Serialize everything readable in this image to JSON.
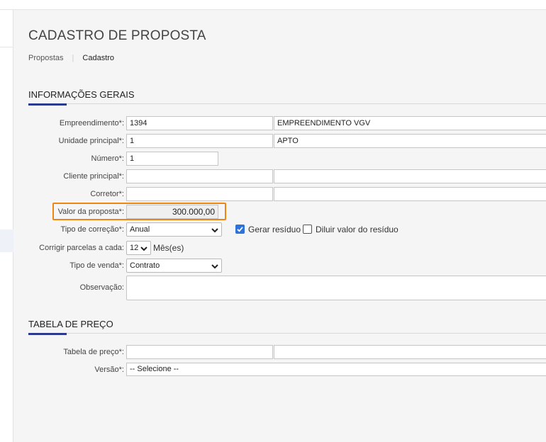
{
  "page": {
    "title": "CADASTRO DE PROPOSTA",
    "breadcrumb": {
      "parent": "Propostas",
      "current": "Cadastro"
    }
  },
  "sections": {
    "general": "INFORMAÇÕES GERAIS",
    "price": "TABELA DE PREÇO"
  },
  "fields": {
    "empreendimento": {
      "label": "Empreendimento*:",
      "code": "1394",
      "name": "EMPREENDIMENTO VGV"
    },
    "unidade": {
      "label": "Unidade principal*:",
      "code": "1",
      "name": "APTO"
    },
    "numero": {
      "label": "Número*:",
      "value": "1"
    },
    "cliente": {
      "label": "Cliente principal*:",
      "code": "",
      "name": ""
    },
    "corretor": {
      "label": "Corretor*:",
      "code": "",
      "name": ""
    },
    "valor": {
      "label": "Valor da proposta*:",
      "value": "300.000,00"
    },
    "tipo_correcao": {
      "label": "Tipo de correção*:",
      "value": "Anual"
    },
    "gerar_residuo": {
      "label": "Gerar resíduo",
      "checked": true
    },
    "diluir_residuo": {
      "label": "Diluir valor do resíduo",
      "checked": false
    },
    "corrigir": {
      "label": "Corrigir parcelas a cada:",
      "value": "12",
      "unit": "Mês(es)"
    },
    "tipo_venda": {
      "label": "Tipo de venda*:",
      "value": "Contrato"
    },
    "observacao": {
      "label": "Observação:",
      "value": ""
    },
    "tabela_preco": {
      "label": "Tabela de preço*:",
      "code": "",
      "name": ""
    },
    "versao": {
      "label": "Versão*:",
      "value": "-- Selecione --"
    }
  },
  "colors": {
    "accent": "#2b3a8c",
    "highlight": "#f0860f",
    "checkbox": "#2f72d8"
  }
}
